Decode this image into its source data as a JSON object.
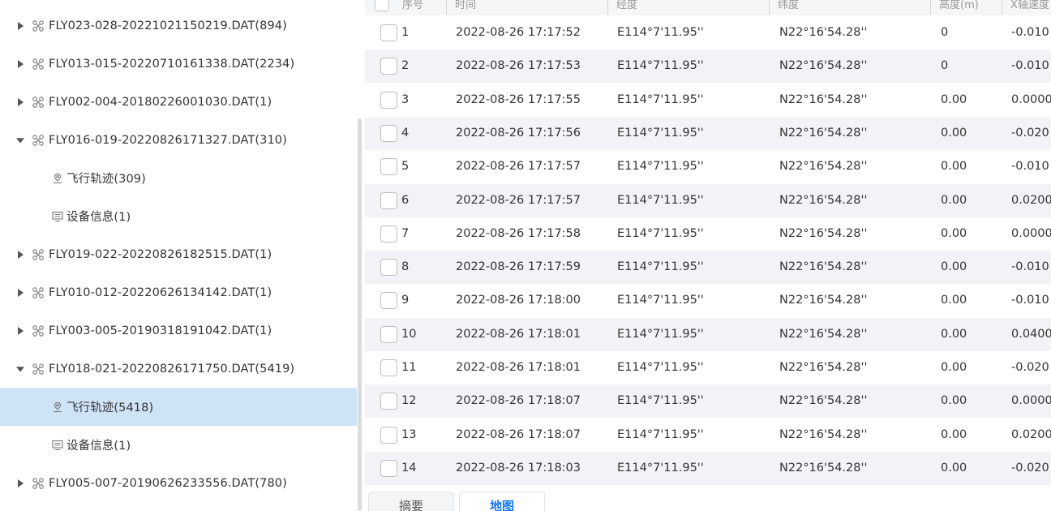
{
  "tree": {
    "items": [
      {
        "kind": "file",
        "expanded": false,
        "label": "FLY023-028-20221021150219.DAT(894)"
      },
      {
        "kind": "file",
        "expanded": false,
        "label": "FLY013-015-20220710161338.DAT(2234)"
      },
      {
        "kind": "file",
        "expanded": false,
        "label": "FLY002-004-20180226001030.DAT(1)"
      },
      {
        "kind": "file",
        "expanded": true,
        "label": "FLY016-019-20220826171327.DAT(310)"
      },
      {
        "kind": "track",
        "label": "飞行轨迹(309)"
      },
      {
        "kind": "device",
        "label": "设备信息(1)"
      },
      {
        "kind": "file",
        "expanded": false,
        "label": "FLY019-022-20220826182515.DAT(1)"
      },
      {
        "kind": "file",
        "expanded": false,
        "label": "FLY010-012-20220626134142.DAT(1)"
      },
      {
        "kind": "file",
        "expanded": false,
        "label": "FLY003-005-20190318191042.DAT(1)"
      },
      {
        "kind": "file",
        "expanded": true,
        "label": "FLY018-021-20220826171750.DAT(5419)"
      },
      {
        "kind": "track",
        "label": "飞行轨迹(5418)",
        "selected": true
      },
      {
        "kind": "device",
        "label": "设备信息(1)"
      },
      {
        "kind": "file",
        "expanded": false,
        "label": "FLY005-007-20190626233556.DAT(780)"
      }
    ]
  },
  "table": {
    "headers": {
      "index": "序号",
      "time": "时间",
      "longitude": "经度",
      "latitude": "纬度",
      "altitude": "高度(m)",
      "x_speed": "X轴速度"
    },
    "rows": [
      {
        "index": "1",
        "time": "2022-08-26 17:17:52",
        "longitude": "E114°7'11.95''",
        "latitude": "N22°16'54.28''",
        "altitude": "0",
        "x_speed": "-0.010"
      },
      {
        "index": "2",
        "time": "2022-08-26 17:17:53",
        "longitude": "E114°7'11.95''",
        "latitude": "N22°16'54.28''",
        "altitude": "0",
        "x_speed": "-0.010"
      },
      {
        "index": "3",
        "time": "2022-08-26 17:17:55",
        "longitude": "E114°7'11.95''",
        "latitude": "N22°16'54.28''",
        "altitude": "0.00",
        "x_speed": "0.0000"
      },
      {
        "index": "4",
        "time": "2022-08-26 17:17:56",
        "longitude": "E114°7'11.95''",
        "latitude": "N22°16'54.28''",
        "altitude": "0.00",
        "x_speed": "-0.020"
      },
      {
        "index": "5",
        "time": "2022-08-26 17:17:57",
        "longitude": "E114°7'11.95''",
        "latitude": "N22°16'54.28''",
        "altitude": "0.00",
        "x_speed": "-0.010"
      },
      {
        "index": "6",
        "time": "2022-08-26 17:17:57",
        "longitude": "E114°7'11.95''",
        "latitude": "N22°16'54.28''",
        "altitude": "0.00",
        "x_speed": "0.0200"
      },
      {
        "index": "7",
        "time": "2022-08-26 17:17:58",
        "longitude": "E114°7'11.95''",
        "latitude": "N22°16'54.28''",
        "altitude": "0.00",
        "x_speed": "0.0000"
      },
      {
        "index": "8",
        "time": "2022-08-26 17:17:59",
        "longitude": "E114°7'11.95''",
        "latitude": "N22°16'54.28''",
        "altitude": "0.00",
        "x_speed": "-0.010"
      },
      {
        "index": "9",
        "time": "2022-08-26 17:18:00",
        "longitude": "E114°7'11.95''",
        "latitude": "N22°16'54.28''",
        "altitude": "0.00",
        "x_speed": "-0.010"
      },
      {
        "index": "10",
        "time": "2022-08-26 17:18:01",
        "longitude": "E114°7'11.95''",
        "latitude": "N22°16'54.28''",
        "altitude": "0.00",
        "x_speed": "0.0400"
      },
      {
        "index": "11",
        "time": "2022-08-26 17:18:01",
        "longitude": "E114°7'11.95''",
        "latitude": "N22°16'54.28''",
        "altitude": "0.00",
        "x_speed": "-0.020"
      },
      {
        "index": "12",
        "time": "2022-08-26 17:18:07",
        "longitude": "E114°7'11.95''",
        "latitude": "N22°16'54.28''",
        "altitude": "0.00",
        "x_speed": "0.0000"
      },
      {
        "index": "13",
        "time": "2022-08-26 17:18:07",
        "longitude": "E114°7'11.95''",
        "latitude": "N22°16'54.28''",
        "altitude": "0.00",
        "x_speed": "0.0200"
      },
      {
        "index": "14",
        "time": "2022-08-26 17:18:03",
        "longitude": "E114°7'11.95''",
        "latitude": "N22°16'54.28''",
        "altitude": "0.00",
        "x_speed": "-0.020"
      }
    ]
  },
  "tabs": {
    "summary": "摘要",
    "map": "地图"
  },
  "colors": {
    "selected_row": "#cfe3f7",
    "accent": "#1677ff",
    "striped_row": "#f2f3f6"
  }
}
